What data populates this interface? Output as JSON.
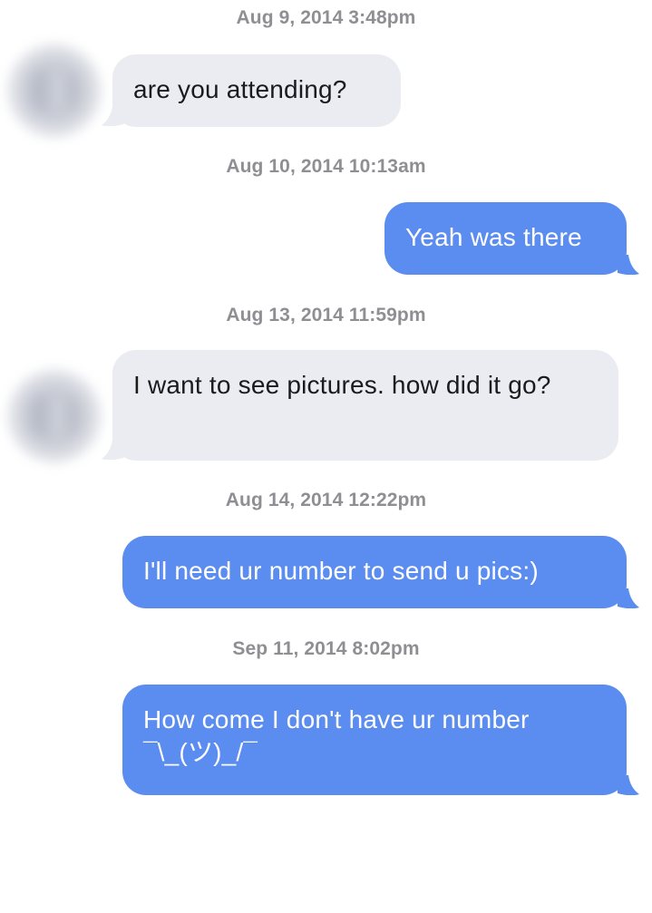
{
  "conversation": {
    "messages": [
      {
        "timestamp": "Aug 9, 2014 3:48pm",
        "direction": "incoming",
        "text": "are you attending?"
      },
      {
        "timestamp": "Aug 10, 2014 10:13am",
        "direction": "outgoing",
        "text": "Yeah was there"
      },
      {
        "timestamp": "Aug 13, 2014 11:59pm",
        "direction": "incoming",
        "text": "I want to see pictures. how did it go?"
      },
      {
        "timestamp": "Aug 14, 2014 12:22pm",
        "direction": "outgoing",
        "text": "I'll need ur number to send u pics:)"
      },
      {
        "timestamp": "Sep 11, 2014 8:02pm",
        "direction": "outgoing",
        "text": "How come I don't have ur number ¯\\_(ツ)_/¯"
      }
    ]
  },
  "colors": {
    "incoming_bubble": "#ebecf1",
    "outgoing_bubble": "#5a8def",
    "timestamp_text": "#8e8e93"
  }
}
